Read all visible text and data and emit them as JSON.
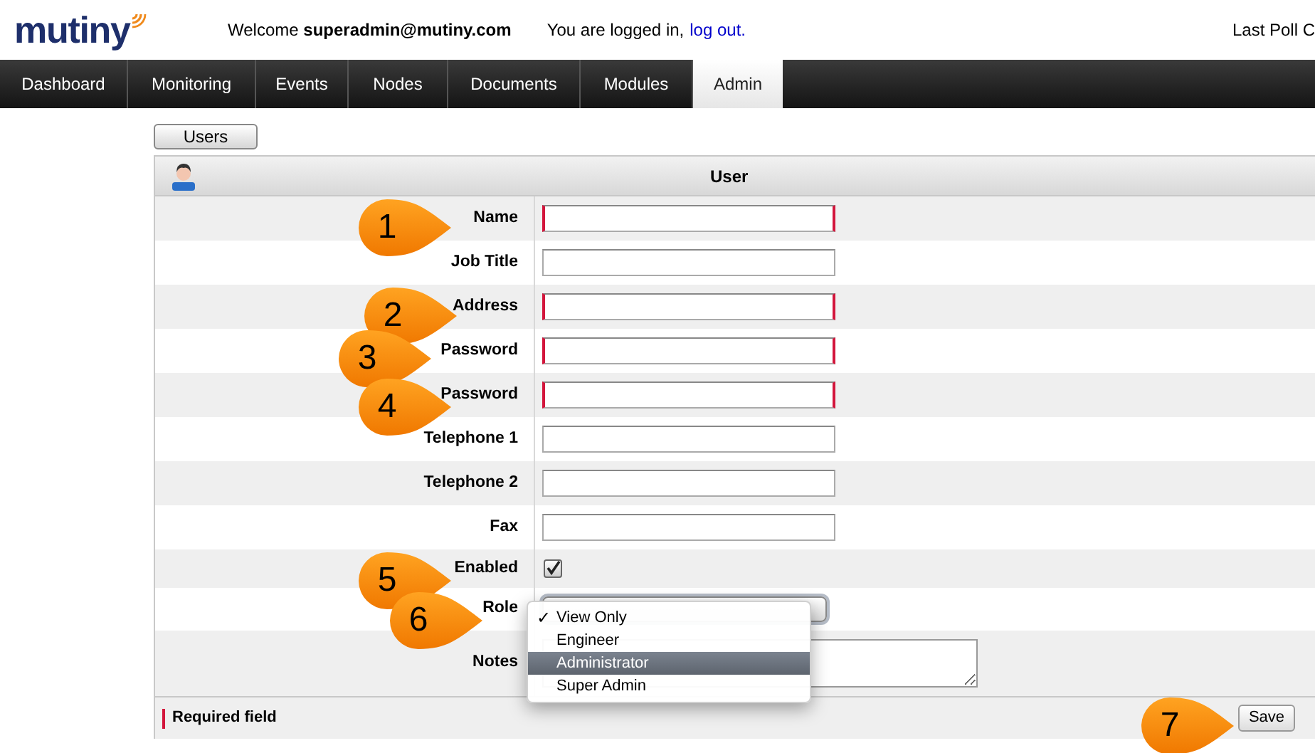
{
  "logo": {
    "text": "mutiny"
  },
  "header": {
    "welcome": "Welcome **superadmin@mutiny.com**",
    "login_status": "You are logged in,",
    "logout_link": "log out.",
    "last_poll": "Last Poll C"
  },
  "nav_tabs": [
    {
      "label": "Dashboard",
      "selected": false
    },
    {
      "label": "Monitoring",
      "selected": false
    },
    {
      "label": "Events",
      "selected": false
    },
    {
      "label": "Nodes",
      "selected": false
    },
    {
      "label": "Documents",
      "selected": false
    },
    {
      "label": "Modules",
      "selected": false
    },
    {
      "label": "Admin",
      "selected": true
    }
  ],
  "users_button": "Users",
  "form": {
    "title": "User",
    "fields": [
      {
        "kind": "text",
        "label": "Name",
        "required": true
      },
      {
        "kind": "text",
        "label": "Job Title",
        "required": false
      },
      {
        "kind": "text",
        "label": "Address",
        "required": true
      },
      {
        "kind": "text",
        "label": "Password",
        "required": true
      },
      {
        "kind": "text",
        "label": "Password",
        "required": true
      },
      {
        "kind": "text",
        "label": "Telephone 1",
        "required": false
      },
      {
        "kind": "text",
        "label": "Telephone 2",
        "required": false
      },
      {
        "kind": "text",
        "label": "Fax",
        "required": false
      },
      {
        "kind": "checkbox",
        "label": "Enabled",
        "checked": true
      },
      {
        "kind": "select",
        "label": "Role"
      },
      {
        "kind": "textarea",
        "label": "Notes"
      }
    ],
    "required_legend": "Required field",
    "save_button": "Save"
  },
  "role_menu": {
    "options": [
      {
        "label": "View Only",
        "selected": true,
        "highlighted": false
      },
      {
        "label": "Engineer",
        "selected": false,
        "highlighted": false
      },
      {
        "label": "Administrator",
        "selected": false,
        "highlighted": true
      },
      {
        "label": "Super Admin",
        "selected": false,
        "highlighted": false
      }
    ],
    "check_mark": "✓"
  },
  "callouts": [
    "1",
    "2",
    "3",
    "4",
    "5",
    "6",
    "7"
  ]
}
